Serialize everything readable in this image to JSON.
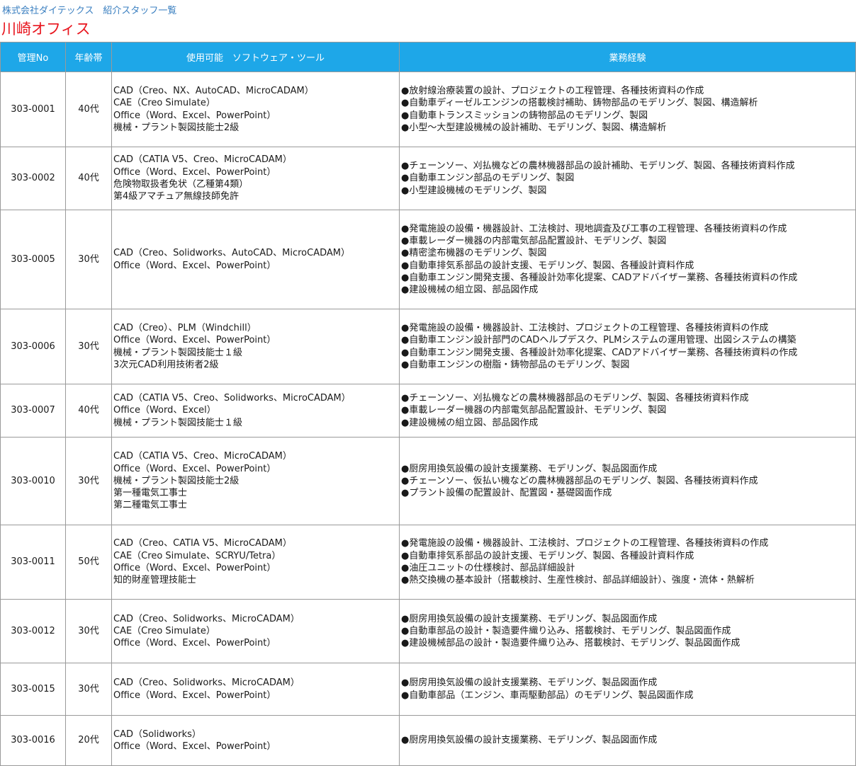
{
  "header": {
    "company_line": "株式会社ダイテックス　紹介スタッフ一覧",
    "office_title": "川崎オフィス"
  },
  "table": {
    "columns": [
      "管理No",
      "年齢帯",
      "使用可能　ソフトウェア・ツール",
      "業務経験"
    ],
    "rows": [
      {
        "id": "303-0001",
        "age": "40代",
        "tools": [
          "CAD（Creo、NX、AutoCAD、MicroCADAM）",
          "CAE（Creo Simulate）",
          "Office（Word、Excel、PowerPoint）",
          "機械・プラント製図技能士2級"
        ],
        "experience": [
          "●放射線治療装置の設計、プロジェクトの工程管理、各種技術資料の作成",
          "●自動車ディーゼルエンジンの搭載検討補助、鋳物部品のモデリング、製図、構造解析",
          "●自動車トランスミッションの鋳物部品のモデリング、製図",
          "●小型～大型建設機械の設計補助、モデリング、製図、構造解析"
        ]
      },
      {
        "id": "303-0002",
        "age": "40代",
        "tools": [
          "CAD（CATIA V5、Creo、MicroCADAM）",
          "Office（Word、Excel、PowerPoint）",
          "危険物取扱者免状（乙種第4類）",
          "第4級アマチュア無線技師免許"
        ],
        "experience": [
          "●チェーンソー、刈払機などの農林機器部品の設計補助、モデリング、製図、各種技術資料作成",
          "●自動車エンジン部品のモデリング、製図",
          "●小型建設機械のモデリング、製図"
        ]
      },
      {
        "id": "303-0005",
        "age": "30代",
        "tools": [
          "CAD（Creo、Solidworks、AutoCAD、MicroCADAM）",
          "Office（Word、Excel、PowerPoint）"
        ],
        "experience": [
          "●発電施設の設備・機器設計、工法検討、現地調査及び工事の工程管理、各種技術資料の作成",
          "●車載レーダー機器の内部電気部品配置設計、モデリング、製図",
          "●精密塗布機器のモデリング、製図",
          "●自動車排気系部品の設計支援、モデリング、製図、各種設計資料作成",
          "●自動車エンジン開発支援、各種設計効率化提案、CADアドバイザー業務、各種技術資料の作成",
          "●建設機械の組立図、部品図作成"
        ]
      },
      {
        "id": "303-0006",
        "age": "30代",
        "tools": [
          "CAD（Creo）、PLM（Windchill）",
          "Office（Word、Excel、PowerPoint）",
          "機械・プラント製図技能士１級",
          "3次元CAD利用技術者2級"
        ],
        "experience": [
          "●発電施設の設備・機器設計、工法検討、プロジェクトの工程管理、各種技術資料の作成",
          "●自動車エンジン設計部門のCADヘルプデスク、PLMシステムの運用管理、出図システムの構築",
          "●自動車エンジン開発支援、各種設計効率化提案、CADアドバイザー業務、各種技術資料の作成",
          "●自動車エンジンの樹脂・鋳物部品のモデリング、製図"
        ]
      },
      {
        "id": "303-0007",
        "age": "40代",
        "tools": [
          "CAD（CATIA V5、Creo、Solidworks、MicroCADAM）",
          "Office（Word、Excel）",
          "機械・プラント製図技能士１級"
        ],
        "experience": [
          "●チェーンソー、刈払機などの農林機器部品のモデリング、製図、各種技術資料作成",
          "●車載レーダー機器の内部電気部品配置設計、モデリング、製図",
          "●建設機械の組立図、部品図作成"
        ]
      },
      {
        "id": "303-0010",
        "age": "30代",
        "tools": [
          "CAD（CATIA V5、Creo、MicroCADAM）",
          "Office（Word、Excel、PowerPoint）",
          "機械・プラント製図技能士2級",
          "第一種電気工事士",
          "第二種電気工事士"
        ],
        "experience": [
          "●厨房用換気設備の設計支援業務、モデリング、製品図面作成",
          "●チェーンソー、仮払い機などの農林機器部品のモデリング、製図、各種技術資料作成",
          "●プラント設備の配置設計、配置図・基礎図面作成"
        ]
      },
      {
        "id": "303-0011",
        "age": "50代",
        "tools": [
          "CAD（Creo、CATIA V5、MicroCADAM）",
          "CAE（Creo Simulate、SCRYU/Tetra）",
          "Office（Word、Excel、PowerPoint）",
          "知的財産管理技能士"
        ],
        "experience": [
          "●発電施設の設備・機器設計、工法検討、プロジェクトの工程管理、各種技術資料の作成",
          "●自動車排気系部品の設計支援、モデリング、製図、各種設計資料作成",
          "●油圧ユニットの仕様検討、部品詳細設計",
          "●熱交換機の基本設計（搭載検討、生産性検討、部品詳細設計）、強度・流体・熱解析"
        ]
      },
      {
        "id": "303-0012",
        "age": "30代",
        "tools": [
          "CAD（Creo、Solidworks、MicroCADAM）",
          "CAE（Creo Simulate）",
          "Office（Word、Excel、PowerPoint）"
        ],
        "experience": [
          "●厨房用換気設備の設計支援業務、モデリング、製品図面作成",
          "●自動車部品の設計・製造要件織り込み、搭載検討、モデリング、製品図面作成",
          "●建設機械部品の設計・製造要件織り込み、搭載検討、モデリング、製品図面作成"
        ]
      },
      {
        "id": "303-0015",
        "age": "30代",
        "tools": [
          "CAD（Creo、Solidworks、MicroCADAM）",
          "Office（Word、Excel、PowerPoint）"
        ],
        "experience": [
          "●厨房用換気設備の設計支援業務、モデリング、製品図面作成",
          "●自動車部品（エンジン、車両駆動部品）のモデリング、製品図面作成"
        ]
      },
      {
        "id": "303-0016",
        "age": "20代",
        "tools": [
          "CAD（Solidworks）",
          "Office（Word、Excel、PowerPoint）"
        ],
        "experience": [
          "●厨房用換気設備の設計支援業務、モデリング、製品図面作成"
        ]
      }
    ]
  }
}
